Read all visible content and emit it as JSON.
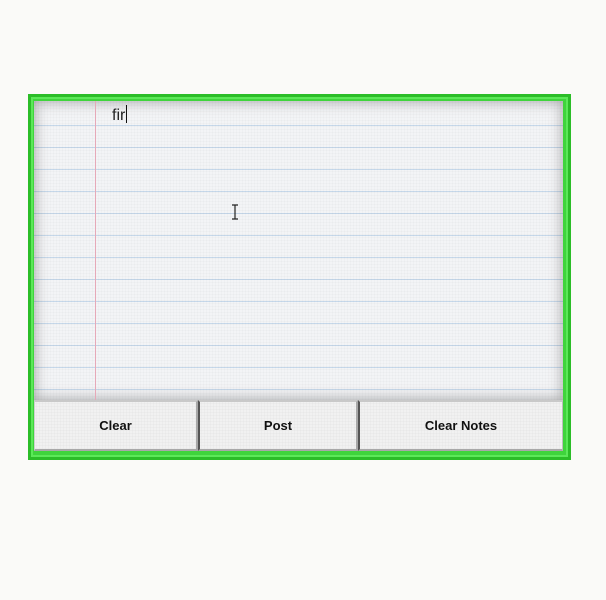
{
  "note": {
    "text": "fir"
  },
  "buttons": {
    "clear_label": "Clear",
    "post_label": "Post",
    "clear_notes_label": "Clear Notes"
  },
  "colors": {
    "frame": "#3fd43c",
    "paper": "#f3f4f6",
    "rule_line": "#c6d8ea",
    "margin_line": "#e6a9b8"
  }
}
